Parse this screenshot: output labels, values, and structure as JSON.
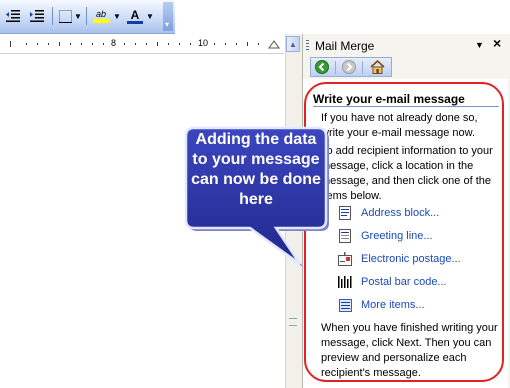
{
  "toolbar": {
    "items": [
      "decrease-indent-icon",
      "increase-indent-icon",
      "borders-icon",
      "highlight-icon",
      "font-color-icon"
    ],
    "highlight_label": "ab",
    "font_color_label": "A"
  },
  "ruler": {
    "labels": [
      "8",
      "10"
    ]
  },
  "task_pane": {
    "title": "Mail Merge",
    "close_symbol": "×",
    "menu_symbol": "▼",
    "heading": "Write your e-mail message",
    "intro": "If you have not already done so, write your e-mail message now.",
    "instruction": "To add recipient information to your message, click a location in the message, and then click one of the items below.",
    "links": [
      {
        "label": "Address block...",
        "icon": "address-block-icon"
      },
      {
        "label": "Greeting line...",
        "icon": "greeting-line-icon"
      },
      {
        "label": "Electronic postage...",
        "icon": "electronic-postage-icon"
      },
      {
        "label": "Postal bar code...",
        "icon": "postal-barcode-icon"
      },
      {
        "label": "More items...",
        "icon": "more-items-icon"
      }
    ],
    "footer": "When you have finished writing your message, click Next. Then you can preview and personalize each recipient's message."
  },
  "callout": {
    "text": "Adding the data to your message can now be done here"
  },
  "colors": {
    "highlight": "#ff0000",
    "callout_fill": "#2b34a6",
    "link": "#1a4bb4"
  }
}
